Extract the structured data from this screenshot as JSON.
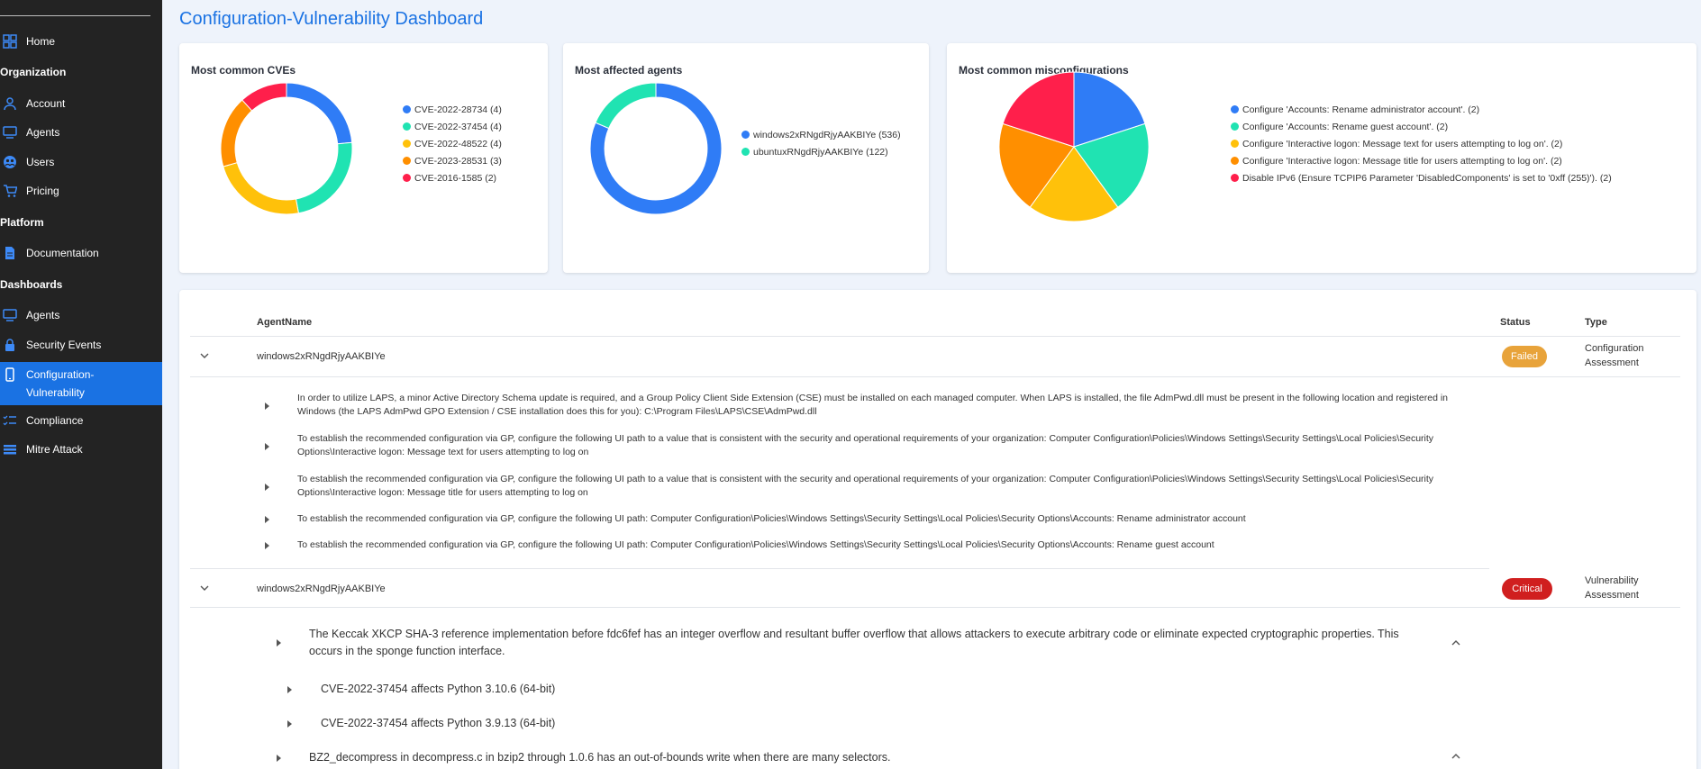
{
  "sidebar": {
    "items": [
      {
        "label": "Home",
        "icon": "grid-icon"
      },
      {
        "label": "Account",
        "icon": "person-icon"
      },
      {
        "label": "Agents",
        "icon": "monitor-icon"
      },
      {
        "label": "Users",
        "icon": "users-icon"
      },
      {
        "label": "Pricing",
        "icon": "cart-icon"
      },
      {
        "label": "Documentation",
        "icon": "document-icon"
      },
      {
        "label": "Agents",
        "icon": "monitor-icon"
      },
      {
        "label": "Security Events",
        "icon": "lock-icon"
      },
      {
        "label": "Configuration-Vulnerability",
        "icon": "phone-icon"
      },
      {
        "label": "Compliance",
        "icon": "checklist-icon"
      },
      {
        "label": "Mitre Attack",
        "icon": "layers-icon"
      }
    ],
    "sections": {
      "organization": "Organization",
      "platform": "Platform",
      "dashboards": "Dashboards"
    },
    "config_vuln_line1": "Configuration-",
    "config_vuln_line2": "Vulnerability"
  },
  "page": {
    "title": "Configuration-Vulnerability Dashboard"
  },
  "cards": {
    "cves": {
      "title": "Most common CVEs",
      "legend": [
        "CVE-2022-28734 (4)",
        "CVE-2022-37454 (4)",
        "CVE-2022-48522 (4)",
        "CVE-2023-28531 (3)",
        "CVE-2016-1585 (2)"
      ]
    },
    "agents": {
      "title": "Most affected agents",
      "legend": [
        "windows2xRNgdRjyAAKBIYe (536)",
        "ubuntuxRNgdRjyAAKBIYe (122)"
      ]
    },
    "misconfig": {
      "title": "Most common misconfigurations",
      "legend": [
        "Configure 'Accounts: Rename administrator account'. (2)",
        "Configure 'Accounts: Rename guest account'. (2)",
        "Configure 'Interactive logon: Message text for users attempting to log on'. (2)",
        "Configure 'Interactive logon: Message title for users attempting to log on'. (2)",
        "Disable IPv6 (Ensure TCPIP6 Parameter 'DisabledComponents' is set to '0xff (255)'). (2)"
      ]
    }
  },
  "chart_data": [
    {
      "type": "pie",
      "title": "Most common CVEs",
      "categories": [
        "CVE-2022-28734",
        "CVE-2022-37454",
        "CVE-2022-48522",
        "CVE-2023-28531",
        "CVE-2016-1585"
      ],
      "values": [
        4,
        4,
        4,
        3,
        2
      ],
      "colors": [
        "#2f7cf6",
        "#20e3b2",
        "#ffc10a",
        "#ff8f00",
        "#ff1f4b"
      ],
      "donut": true
    },
    {
      "type": "pie",
      "title": "Most affected agents",
      "categories": [
        "windows2xRNgdRjyAAKBIYe",
        "ubuntuxRNgdRjyAAKBIYe"
      ],
      "values": [
        536,
        122
      ],
      "colors": [
        "#2f7cf6",
        "#20e3b2"
      ],
      "donut": true
    },
    {
      "type": "pie",
      "title": "Most common misconfigurations",
      "categories": [
        "Configure 'Accounts: Rename administrator account'.",
        "Configure 'Accounts: Rename guest account'.",
        "Configure 'Interactive logon: Message text for users attempting to log on'.",
        "Configure 'Interactive logon: Message title for users attempting to log on'.",
        "Disable IPv6 (Ensure TCPIP6 Parameter 'DisabledComponents' is set to '0xff (255)')."
      ],
      "values": [
        2,
        2,
        2,
        2,
        2
      ],
      "colors": [
        "#2f7cf6",
        "#20e3b2",
        "#ffc10a",
        "#ff8f00",
        "#ff1f4b"
      ],
      "donut": false
    }
  ],
  "table": {
    "headers": {
      "agent": "AgentName",
      "status": "Status",
      "type": "Type"
    },
    "rows": [
      {
        "agent": "windows2xRNgdRjyAAKBIYe",
        "status": "Failed",
        "status_color": "#e8a33a",
        "type_line1": "Configuration",
        "type_line2": "Assessment",
        "details": [
          "In order to utilize LAPS, a minor Active Directory Schema update is required, and a Group Policy Client Side Extension (CSE) must be installed on each managed computer. When LAPS is installed, the file AdmPwd.dll must be present in the following location and registered in Windows (the LAPS AdmPwd GPO Extension / CSE installation does this for you): C:\\Program Files\\LAPS\\CSE\\AdmPwd.dll",
          "To establish the recommended configuration via GP, configure the following UI path to a value that is consistent with the security and operational requirements of your organization: Computer Configuration\\Policies\\Windows Settings\\Security Settings\\Local Policies\\Security Options\\Interactive logon: Message text for users attempting to log on",
          "To establish the recommended configuration via GP, configure the following UI path to a value that is consistent with the security and operational requirements of your organization: Computer Configuration\\Policies\\Windows Settings\\Security Settings\\Local Policies\\Security Options\\Interactive logon: Message title for users attempting to log on",
          "To establish the recommended configuration via GP, configure the following UI path: Computer Configuration\\Policies\\Windows Settings\\Security Settings\\Local Policies\\Security Options\\Accounts: Rename administrator account",
          "To establish the recommended configuration via GP, configure the following UI path: Computer Configuration\\Policies\\Windows Settings\\Security Settings\\Local Policies\\Security Options\\Accounts: Rename guest account"
        ]
      },
      {
        "agent": "windows2xRNgdRjyAAKBIYe",
        "status": "Critical",
        "status_color": "#d01f1f",
        "type_line1": "Vulnerability",
        "type_line2": "Assessment",
        "vulns": [
          "The Keccak XKCP SHA-3 reference implementation before fdc6fef has an integer overflow and resultant buffer overflow that allows attackers to execute arbitrary code or eliminate expected cryptographic properties. This occurs in the sponge function interface.",
          "BZ2_decompress in decompress.c in bzip2 through 1.0.6 has an out-of-bounds write when there are many selectors."
        ],
        "affects": [
          "CVE-2022-37454 affects Python 3.10.6 (64-bit)",
          "CVE-2022-37454 affects Python 3.9.13 (64-bit)"
        ]
      }
    ]
  }
}
